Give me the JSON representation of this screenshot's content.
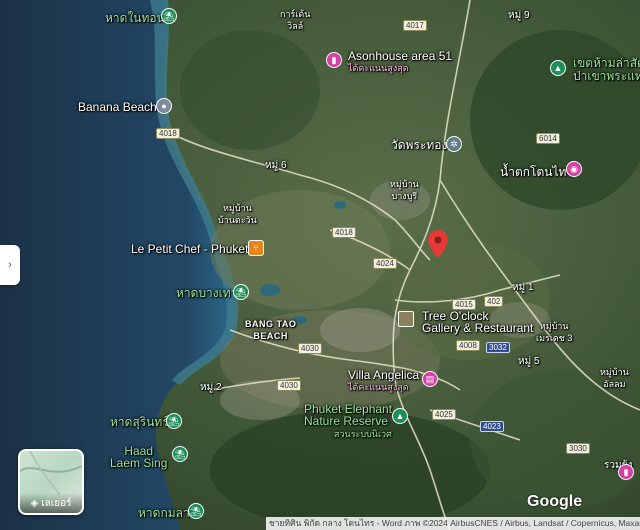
{
  "labels": {
    "had_nai_thon": "หาดในทอน",
    "banana_beach": "Banana Beach",
    "kaset_villa": "การ์เด้น\nวิลล์",
    "asonhouse": "Asonhouse area 51",
    "asonhouse_sub": "ได้คะแนนสูงสุด",
    "wat_phra_thong": "วัดพระทอง",
    "khet_ham_la": "เขตห้ามล่าสัตว์",
    "khao_phra_kaeo": "ป่าเขาพระแทว",
    "nam_tok_ton_sai": "น้ำตกโตนไทร",
    "moo6": "หมู่ 6",
    "moo_ban_bang_pu": "หมู่บ้าน\nบางบูรี",
    "moo_ban_tatun": "หมู่บ้าน\nบ้านตะวัน",
    "le_petit_chef": "Le Petit Chef - Phuket",
    "had_bang_tao": "หาดบางเทา",
    "bang_tao_beach": "BANG TAO\nBEACH",
    "tree_oclock": "Tree O'clock\nGallery & Restaurant",
    "moo1": "หมู่ 1",
    "moo_ban_3": "หมู่บ้าน\nเมรเดช 3",
    "moo5": "หมู่ 5",
    "villa_angelica": "Villa Angelica",
    "villa_angelica_sub": "ได้คะแนนสูงสุด",
    "moo2": "หมู่ 2",
    "phuket_elephant": "Phuket Elephant\nNature Reserve",
    "elephant_sub": "สวนระบบนิเวศ",
    "had_surin": "หาดสุรินทร์",
    "haad_laem_sing": "Haad\nLaem Sing",
    "had_kamala": "หาดกมลา",
    "moo_ban_right": "หมู่บ้าน\nอัลลม",
    "ruam_yu": "รวมยุ้ง",
    "moo9": "หมู่ 9"
  },
  "roads": {
    "r4018": "4018",
    "r4024": "4024",
    "r4015": "4015",
    "r4008": "4008",
    "r4030a": "4030",
    "r4030b": "4030",
    "r4025": "4025",
    "r4023": "4023",
    "r3030": "3030",
    "r3032": "3032",
    "r402": "402",
    "r4017": "4017",
    "r6014": "6014",
    "r4018b": "4018"
  },
  "icons": {
    "beach": "beach-icon",
    "place": "place-icon",
    "poi": "shopping-icon",
    "food": "fork-knife-icon",
    "temple": "temple-icon",
    "park": "tree-icon",
    "hotel": "hotel-icon",
    "layers": "layers-icon"
  },
  "controls": {
    "layers_label": "เลเยอร์",
    "side_toggle": "›"
  },
  "branding": {
    "logo": "Google",
    "attribution": "ชายทิศิน พิกัด กลาง โดนไทร - Word   ภาพ ©2024 AirbusCNES / Airbus, Landsat / Copernicus, Maxar Technologies"
  },
  "colors": {
    "sea": "#1f3b52",
    "land": "#3a4a34",
    "accent_red": "#e53935"
  }
}
